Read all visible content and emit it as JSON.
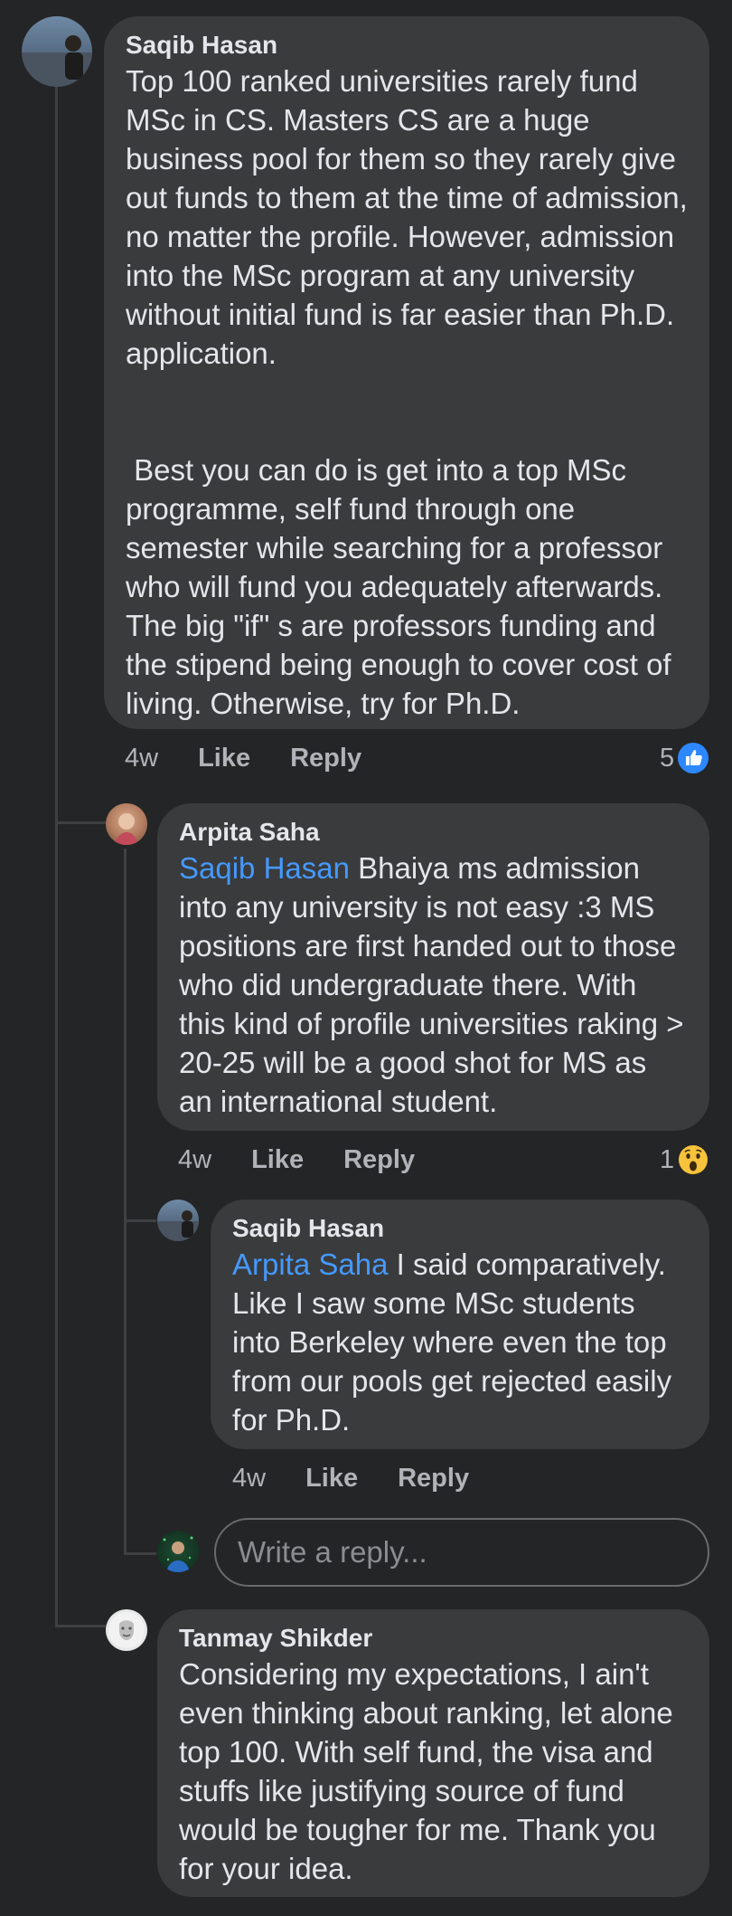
{
  "comments": [
    {
      "author": "Saqib Hasan",
      "text": "Top 100 ranked universities rarely fund MSc in CS. Masters CS are a huge business pool for them so they rarely give out funds to them at the time of admission, no matter the profile. However, admission into the MSc program at any university without initial fund is far easier than Ph.D. application.\n\n\n Best you can do is get into a top MSc programme, self fund through one semester while searching for a professor who will fund you adequately afterwards. The big \"if\" s are professors funding and the stipend being enough to cover cost of living. Otherwise, try for Ph.D.",
      "time": "4w",
      "like_label": "Like",
      "reply_label": "Reply",
      "reaction_count": "5",
      "reaction_icon": "like-icon"
    },
    {
      "author": "Arpita Saha",
      "mention": "Saqib Hasan",
      "text": " Bhaiya ms admission into any university is not easy :3 MS positions are first handed out to those who did undergraduate there. With this kind of profile universities raking > 20-25 will be a good shot for MS as an international student.",
      "time": "4w",
      "like_label": "Like",
      "reply_label": "Reply",
      "reaction_count": "1",
      "reaction_icon": "wow-icon"
    },
    {
      "author": "Saqib Hasan",
      "mention": "Arpita Saha",
      "text": " I said comparatively. Like I saw some MSc students into Berkeley where even the top from our pools get rejected easily for Ph.D.",
      "time": "4w",
      "like_label": "Like",
      "reply_label": "Reply"
    },
    {
      "author": "Tanmay Shikder",
      "text": "Considering my expectations, I ain't even thinking about ranking, let alone top 100. With self fund, the visa and stuffs like justifying source of fund would be tougher for me. Thank you for your idea."
    }
  ],
  "reply_box": {
    "placeholder": "Write a reply..."
  },
  "colors": {
    "background": "#242526",
    "bubble": "#3a3b3c",
    "mention": "#4599ff",
    "like_blue": "#2d88ff"
  }
}
